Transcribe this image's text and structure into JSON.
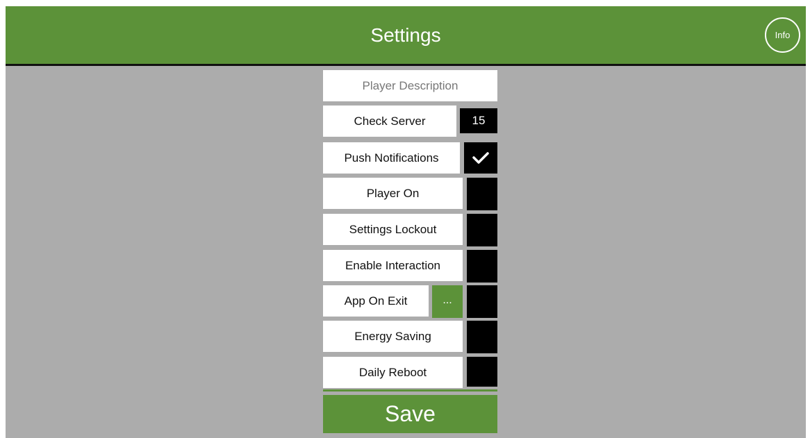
{
  "header": {
    "title": "Settings",
    "info_label": "Info"
  },
  "player_description": {
    "placeholder": "Player Description"
  },
  "check_server": {
    "label": "Check Server",
    "value": "15"
  },
  "settings": [
    {
      "label": "Push Notifications",
      "checked": true
    },
    {
      "label": "Player On",
      "checked": false
    },
    {
      "label": "Settings Lockout",
      "checked": false
    },
    {
      "label": "Enable Interaction",
      "checked": false
    }
  ],
  "app_on_exit": {
    "label": "App On Exit",
    "button": "...",
    "checked": false
  },
  "settings_bottom": [
    {
      "label": "Energy Saving",
      "checked": false
    },
    {
      "label": "Daily Reboot",
      "checked": false
    }
  ],
  "save": {
    "label": "Save"
  },
  "colors": {
    "accent": "#5c9239",
    "background": "#acacac",
    "box": "#000000"
  }
}
